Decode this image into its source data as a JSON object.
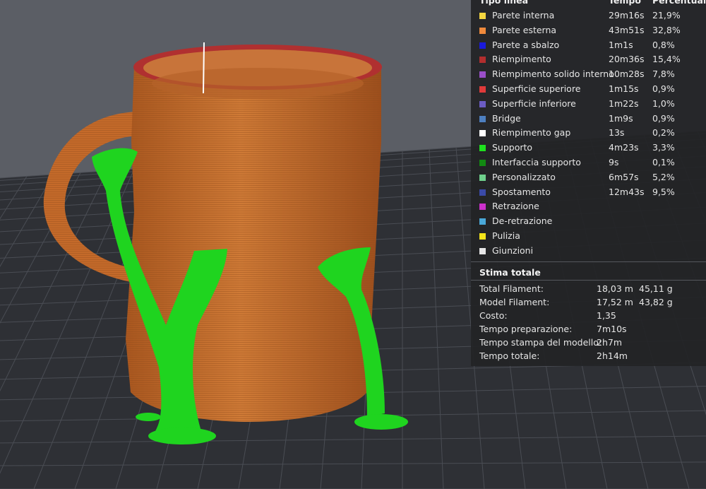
{
  "legend": {
    "header": {
      "col_type": "Tipo linea",
      "col_time": "Tempo",
      "col_pct": "Percentuale"
    },
    "rows": [
      {
        "label": "Parete interna",
        "time": "29m16s",
        "pct": "21,9%",
        "color": "#f4d640"
      },
      {
        "label": "Parete esterna",
        "time": "43m51s",
        "pct": "32,8%",
        "color": "#f08a3c"
      },
      {
        "label": "Parete a sbalzo",
        "time": "1m1s",
        "pct": "0,8%",
        "color": "#1a1adc"
      },
      {
        "label": "Riempimento",
        "time": "20m36s",
        "pct": "15,4%",
        "color": "#b22e2e"
      },
      {
        "label": "Riempimento solido interno",
        "time": "10m28s",
        "pct": "7,8%",
        "color": "#9a4ec9"
      },
      {
        "label": "Superficie superiore",
        "time": "1m15s",
        "pct": "0,9%",
        "color": "#e03a3a"
      },
      {
        "label": "Superficie inferiore",
        "time": "1m22s",
        "pct": "1,0%",
        "color": "#6b5cc4"
      },
      {
        "label": "Bridge",
        "time": "1m9s",
        "pct": "0,9%",
        "color": "#4d7fc0"
      },
      {
        "label": "Riempimento gap",
        "time": "13s",
        "pct": "0,2%",
        "color": "#ffffff"
      },
      {
        "label": "Supporto",
        "time": "4m23s",
        "pct": "3,3%",
        "color": "#1ee01e"
      },
      {
        "label": "Interfaccia supporto",
        "time": "9s",
        "pct": "0,1%",
        "color": "#128a12"
      },
      {
        "label": "Personalizzato",
        "time": "6m57s",
        "pct": "5,2%",
        "color": "#6fd08c"
      },
      {
        "label": "Spostamento",
        "time": "12m43s",
        "pct": "9,5%",
        "color": "#3a4aa8"
      },
      {
        "label": "Retrazione",
        "time": "",
        "pct": "",
        "color": "#cc30cc"
      },
      {
        "label": "De-retrazione",
        "time": "",
        "pct": "",
        "color": "#4aa8d8"
      },
      {
        "label": "Pulizia",
        "time": "",
        "pct": "",
        "color": "#f4e41a"
      },
      {
        "label": "Giunzioni",
        "time": "",
        "pct": "",
        "color": "#e6e6e6"
      }
    ]
  },
  "summary": {
    "title": "Stima totale",
    "rows": [
      {
        "label": "Total Filament:",
        "value": "18,03 m",
        "weight": "45,11 g"
      },
      {
        "label": "Model Filament:",
        "value": "17,52 m",
        "weight": "43,82 g"
      },
      {
        "label": "Costo:",
        "value": "1,35",
        "weight": ""
      },
      {
        "label": "Tempo preparazione:",
        "value": "7m10s",
        "weight": ""
      },
      {
        "label": "Tempo stampa del modello:",
        "value": "2h7m",
        "weight": ""
      },
      {
        "label": "Tempo totale:",
        "value": "2h14m",
        "weight": ""
      }
    ]
  },
  "colors": {
    "background": "#5b5e65",
    "bed": "#2e3035",
    "grid": "#4a4d54",
    "mug": "#c46a2a",
    "support": "#1fd41f"
  }
}
